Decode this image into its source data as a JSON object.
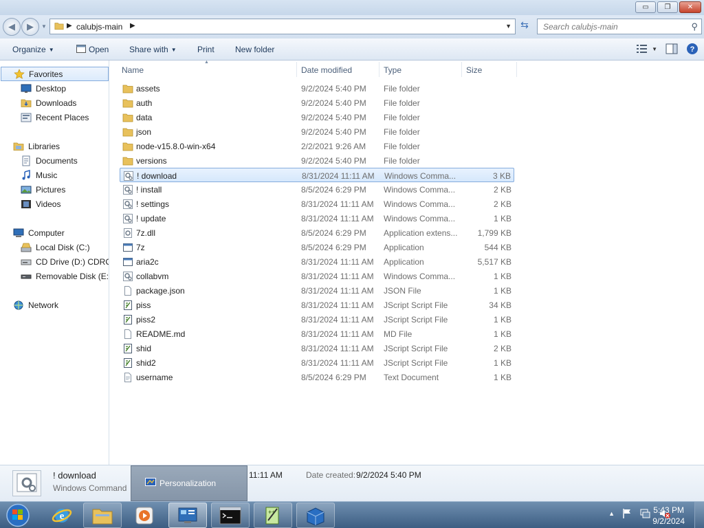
{
  "window": {
    "controls": {
      "minimize": "▭",
      "maximize": "❐",
      "close": "✕"
    }
  },
  "address": {
    "path": "calubjs-main",
    "search_placeholder": "Search calubjs-main"
  },
  "toolbar": {
    "organize": "Organize",
    "open": "Open",
    "share_with": "Share with",
    "print": "Print",
    "new_folder": "New folder"
  },
  "nav": {
    "favorites": "Favorites",
    "desktop": "Desktop",
    "downloads": "Downloads",
    "recent_places": "Recent Places",
    "libraries": "Libraries",
    "documents": "Documents",
    "music": "Music",
    "pictures": "Pictures",
    "videos": "Videos",
    "computer": "Computer",
    "local_disk": "Local Disk (C:)",
    "cd_drive": "CD Drive (D:) CDROM",
    "removable_disk": "Removable Disk (E:)",
    "network": "Network"
  },
  "columns": {
    "name": "Name",
    "date": "Date modified",
    "type": "Type",
    "size": "Size"
  },
  "files": [
    {
      "name": "assets",
      "date": "9/2/2024 5:40 PM",
      "type": "File folder",
      "size": "",
      "icon": "folder-icon",
      "selected": false
    },
    {
      "name": "auth",
      "date": "9/2/2024 5:40 PM",
      "type": "File folder",
      "size": "",
      "icon": "folder-icon",
      "selected": false
    },
    {
      "name": "data",
      "date": "9/2/2024 5:40 PM",
      "type": "File folder",
      "size": "",
      "icon": "folder-icon",
      "selected": false
    },
    {
      "name": "json",
      "date": "9/2/2024 5:40 PM",
      "type": "File folder",
      "size": "",
      "icon": "folder-icon",
      "selected": false
    },
    {
      "name": "node-v15.8.0-win-x64",
      "date": "2/2/2021 9:26 AM",
      "type": "File folder",
      "size": "",
      "icon": "folder-icon",
      "selected": false
    },
    {
      "name": "versions",
      "date": "9/2/2024 5:40 PM",
      "type": "File folder",
      "size": "",
      "icon": "folder-icon",
      "selected": false
    },
    {
      "name": "! download",
      "date": "8/31/2024 11:11 AM",
      "type": "Windows Comma...",
      "size": "3 KB",
      "icon": "batch-file-icon",
      "selected": true
    },
    {
      "name": "! install",
      "date": "8/5/2024 6:29 PM",
      "type": "Windows Comma...",
      "size": "2 KB",
      "icon": "batch-file-icon",
      "selected": false
    },
    {
      "name": "! settings",
      "date": "8/31/2024 11:11 AM",
      "type": "Windows Comma...",
      "size": "2 KB",
      "icon": "batch-file-icon",
      "selected": false
    },
    {
      "name": "! update",
      "date": "8/31/2024 11:11 AM",
      "type": "Windows Comma...",
      "size": "1 KB",
      "icon": "batch-file-icon",
      "selected": false
    },
    {
      "name": "7z.dll",
      "date": "8/5/2024 6:29 PM",
      "type": "Application extens...",
      "size": "1,799 KB",
      "icon": "dll-file-icon",
      "selected": false
    },
    {
      "name": "7z",
      "date": "8/5/2024 6:29 PM",
      "type": "Application",
      "size": "544 KB",
      "icon": "application-icon",
      "selected": false
    },
    {
      "name": "aria2c",
      "date": "8/31/2024 11:11 AM",
      "type": "Application",
      "size": "5,517 KB",
      "icon": "application-icon",
      "selected": false
    },
    {
      "name": "collabvm",
      "date": "8/31/2024 11:11 AM",
      "type": "Windows Comma...",
      "size": "1 KB",
      "icon": "batch-file-icon",
      "selected": false
    },
    {
      "name": "package.json",
      "date": "8/31/2024 11:11 AM",
      "type": "JSON File",
      "size": "1 KB",
      "icon": "blank-file-icon",
      "selected": false
    },
    {
      "name": "piss",
      "date": "8/31/2024 11:11 AM",
      "type": "JScript Script File",
      "size": "34 KB",
      "icon": "script-file-icon",
      "selected": false
    },
    {
      "name": "piss2",
      "date": "8/31/2024 11:11 AM",
      "type": "JScript Script File",
      "size": "1 KB",
      "icon": "script-file-icon",
      "selected": false
    },
    {
      "name": "README.md",
      "date": "8/31/2024 11:11 AM",
      "type": "MD File",
      "size": "1 KB",
      "icon": "blank-file-icon",
      "selected": false
    },
    {
      "name": "shid",
      "date": "8/31/2024 11:11 AM",
      "type": "JScript Script File",
      "size": "2 KB",
      "icon": "script-file-icon",
      "selected": false
    },
    {
      "name": "shid2",
      "date": "8/31/2024 11:11 AM",
      "type": "JScript Script File",
      "size": "1 KB",
      "icon": "script-file-icon",
      "selected": false
    },
    {
      "name": "username",
      "date": "8/5/2024 6:29 PM",
      "type": "Text Document",
      "size": "1 KB",
      "icon": "text-file-icon",
      "selected": false
    }
  ],
  "details": {
    "name": "! download",
    "type": "Windows Command",
    "modified_time": "11:11 AM",
    "created_label": "Date created:",
    "created_value": "9/2/2024 5:40 PM"
  },
  "tooltip": {
    "label": "Personalization"
  },
  "taskbar": {
    "clock_time": "5:43 PM",
    "clock_date": "9/2/2024",
    "tray_arrow": "▲"
  },
  "colors": {
    "selection_border": "#84acdd",
    "link_text": "#1e395b",
    "taskbar_top": "#6f8fb0",
    "taskbar_bottom": "#3c5d82"
  }
}
